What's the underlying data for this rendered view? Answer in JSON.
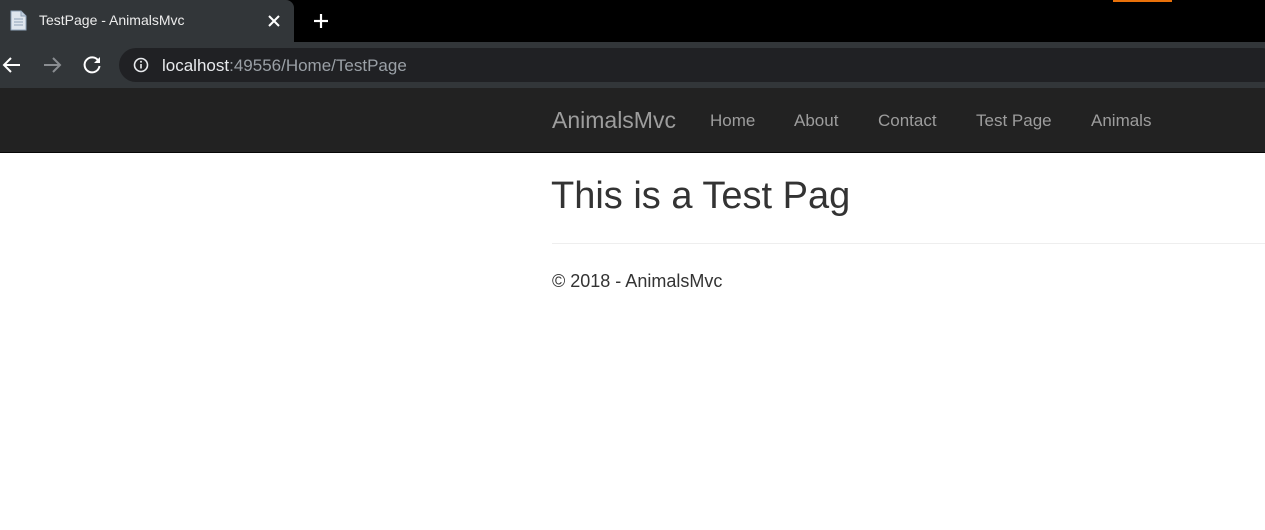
{
  "browser": {
    "tab": {
      "title": "TestPage - AnimalsMvc",
      "favicon": "document-icon"
    },
    "address_bar": {
      "host": "localhost",
      "path": ":49556/Home/TestPage"
    },
    "icons": {
      "back": "arrow-left-icon",
      "forward": "arrow-right-icon",
      "reload": "reload-icon",
      "info": "info-circle-icon",
      "close": "close-icon",
      "new_tab": "plus-icon"
    }
  },
  "site": {
    "brand": "AnimalsMvc",
    "nav": {
      "home": "Home",
      "about": "About",
      "contact": "Contact",
      "test_page": "Test Page",
      "animals": "Animals"
    },
    "heading": "This is a Test Pag",
    "footer": "© 2018 - AnimalsMvc"
  },
  "colors": {
    "navbar_bg": "#222222",
    "nav_text": "#9d9d9d",
    "heading_text": "#333333",
    "chrome_bg": "#323639"
  }
}
